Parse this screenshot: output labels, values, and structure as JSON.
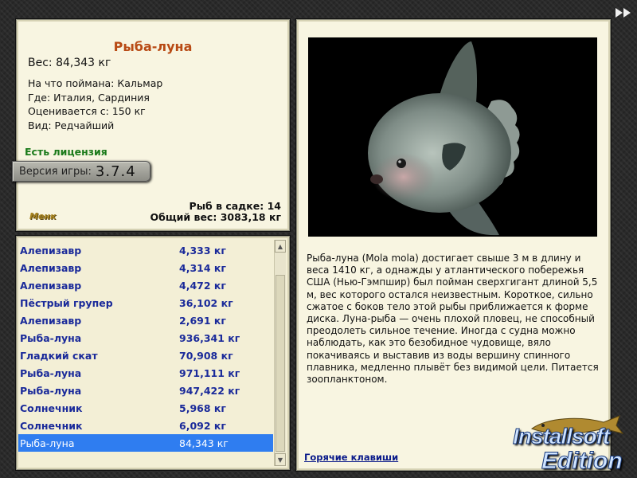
{
  "fish": {
    "name": "Рыба-луна",
    "weight": "Вес: 84,343 кг",
    "bait": "На что поймана: Кальмар",
    "location": "Где: Италия, Сардиния",
    "rating": "Оценивается с: 150 кг",
    "kind": "Вид: Редчайший"
  },
  "license": "Есть лицензия",
  "version": {
    "label": "Версия игры:",
    "number": "3.7.4"
  },
  "brand": "Менк",
  "stats": {
    "in_keepnet": "Рыб в садке: 14",
    "total_weight": "Общий вес: 3083,18 кг"
  },
  "description": "Рыба-луна (Mola mola) достигает свыше 3 м в длину и веса 1410 кг, а однажды у атлантического побережья США (Нью-Гэмпшир) был пойман сверхгигант длиной 5,5 м, вес которого остался неизвестным. Короткое, сильно сжатое с боков тело этой рыбы приближается к форме диска. Луна-рыба — очень плохой пловец, не способный преодолеть сильное течение. Иногда с судна можно наблюдать, как это безобидное чудовище, вяло покачиваясь и выставив из воды вершину спинного плавника, медленно плывёт без видимой цели. Питается зоопланктоном.",
  "hotkeys": "Горячие клавиши",
  "catches": [
    {
      "name": "Алепизавр",
      "weight": "4,333 кг"
    },
    {
      "name": "Алепизавр",
      "weight": "4,314 кг"
    },
    {
      "name": "Алепизавр",
      "weight": "4,472 кг"
    },
    {
      "name": "Пёстрый групер",
      "weight": "36,102 кг"
    },
    {
      "name": "Алепизавр",
      "weight": "2,691 кг"
    },
    {
      "name": "Рыба-луна",
      "weight": "936,341 кг"
    },
    {
      "name": "Гладкий скат",
      "weight": "70,908 кг"
    },
    {
      "name": "Рыба-луна",
      "weight": "971,111 кг"
    },
    {
      "name": "Рыба-луна",
      "weight": "947,422 кг"
    },
    {
      "name": "Солнечник",
      "weight": "5,968 кг"
    },
    {
      "name": "Солнечник",
      "weight": "6,092 кг"
    },
    {
      "name": "Рыба-луна",
      "weight": "84,343 кг"
    }
  ],
  "selected_index": 11,
  "watermark": {
    "line1": "Installsoft",
    "line2": "Edition"
  },
  "icons": {
    "next": "double-arrow-right-icon",
    "scroll_up": "arrow-up-icon",
    "scroll_down": "arrow-down-icon"
  },
  "colors": {
    "title": "#b84a14",
    "license": "#1a7a1a",
    "list_text": "#1a2a9a",
    "selection": "#2f7df0",
    "link": "#0a1a8a"
  }
}
